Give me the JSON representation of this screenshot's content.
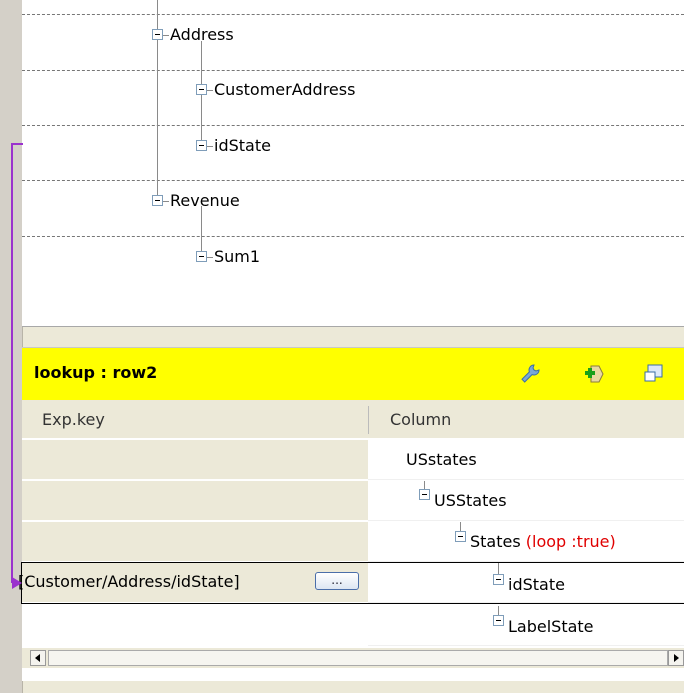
{
  "output_tree": {
    "items": [
      {
        "label": "Address"
      },
      {
        "label": "CustomerAddress"
      },
      {
        "label": "idState"
      },
      {
        "label": "Revenue"
      },
      {
        "label": "Sum1"
      }
    ]
  },
  "lookup": {
    "title": "lookup : row2",
    "columns": {
      "exp_key": "Exp.key",
      "column": "Column"
    },
    "rows": [
      {
        "exp_key": "",
        "column": "USstates",
        "annotation": ""
      },
      {
        "exp_key": "",
        "column": "USStates",
        "annotation": ""
      },
      {
        "exp_key": "",
        "column": "States",
        "annotation": "(loop :true)"
      },
      {
        "exp_key": "Customer/Address/idState]",
        "exp_prefix": "[",
        "column": "idState",
        "annotation": ""
      },
      {
        "exp_key": "",
        "column": "LabelState",
        "annotation": ""
      }
    ],
    "expression_button_label": "...",
    "icons": [
      "wrench-icon",
      "add-expression-icon",
      "settings-window-icon"
    ]
  },
  "colors": {
    "header_bg": "#ffff00",
    "link_line": "#9a32cd",
    "loop_text": "#e00000"
  }
}
